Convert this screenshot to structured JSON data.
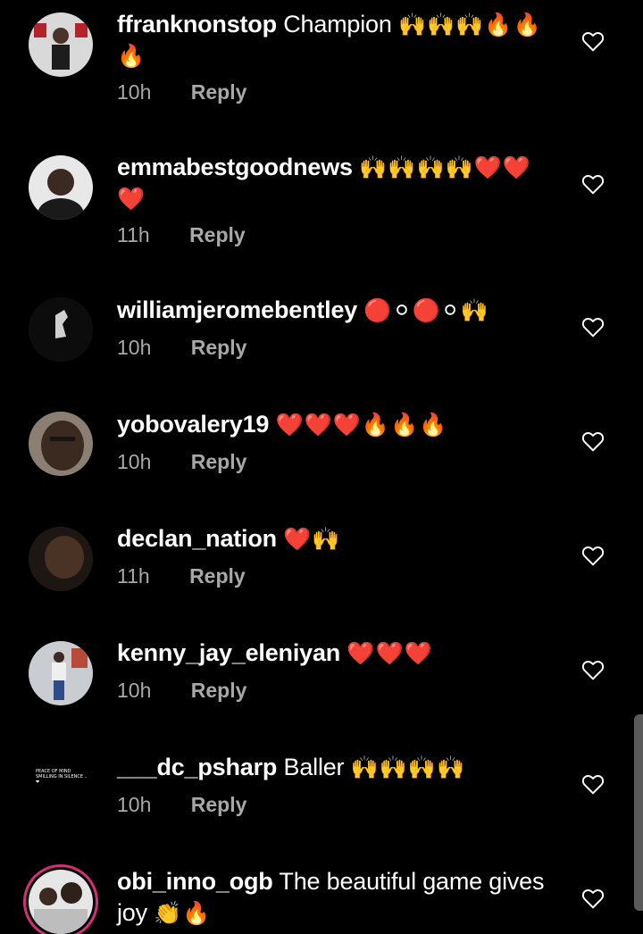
{
  "comments": [
    {
      "username": "ffranknonstop",
      "text": "Champion",
      "emoji": "🙌🙌🙌🔥🔥🔥",
      "time": "10h",
      "reply": "Reply"
    },
    {
      "username": "emmabestgoodnews",
      "text": "",
      "emoji": "🙌🙌🙌🙌❤️❤️❤️",
      "time": "11h",
      "reply": "Reply"
    },
    {
      "username": "williamjeromebentley",
      "text": "",
      "emoji": "🔴⚪🔴⚪🙌",
      "time": "10h",
      "reply": "Reply"
    },
    {
      "username": "yobovalery19",
      "text": "",
      "emoji": "❤️❤️❤️🔥🔥🔥",
      "time": "10h",
      "reply": "Reply"
    },
    {
      "username": "declan_nation",
      "text": "",
      "emoji": "❤️🙌",
      "time": "11h",
      "reply": "Reply"
    },
    {
      "username": "kenny_jay_eleniyan",
      "text": "",
      "emoji": "❤️❤️❤️",
      "time": "10h",
      "reply": "Reply"
    },
    {
      "username": "___dc_psharp",
      "text": "Baller",
      "emoji": "🙌🙌🙌🙌",
      "time": "10h",
      "reply": "Reply"
    },
    {
      "username": "obi_inno_ogb",
      "text": "The beautiful game gives joy",
      "emoji": "👏🔥",
      "time": "",
      "reply": ""
    }
  ],
  "avatar_texts": {
    "dc_psharp": "PEACE OF MIND SMILLING IN SILENCE ..❤"
  },
  "colors": {
    "background": "#000000",
    "text": "#ffffff",
    "meta": "#a8a8a8",
    "story_ring": "#d62d7a"
  },
  "icons": {
    "like": "heart-outline-icon"
  }
}
